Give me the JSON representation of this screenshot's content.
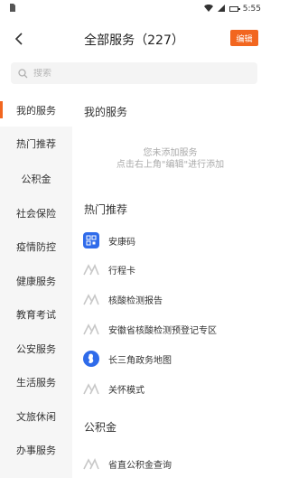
{
  "status_bar": {
    "left_text": "",
    "time": "5:55"
  },
  "header": {
    "title": "全部服务（227）",
    "edit_label": "编辑"
  },
  "search": {
    "placeholder": "搜索"
  },
  "sidebar": {
    "items": [
      {
        "label": "我的服务",
        "active": true
      },
      {
        "label": "热门推荐",
        "active": false
      },
      {
        "label": "公积金",
        "active": false
      },
      {
        "label": "社会保险",
        "active": false
      },
      {
        "label": "疫情防控",
        "active": false
      },
      {
        "label": "健康服务",
        "active": false
      },
      {
        "label": "教育考试",
        "active": false
      },
      {
        "label": "公安服务",
        "active": false
      },
      {
        "label": "生活服务",
        "active": false
      },
      {
        "label": "文旅休闲",
        "active": false
      },
      {
        "label": "办事服务",
        "active": false
      }
    ]
  },
  "main": {
    "my_services": {
      "title": "我的服务",
      "empty_line1": "您未添加服务",
      "empty_line2": "点击右上角\"编辑\"进行添加"
    },
    "hot": {
      "title": "热门推荐",
      "items": [
        {
          "label": "安康码",
          "icon": "qr-code-icon"
        },
        {
          "label": "行程卡",
          "icon": "placeholder-logo-icon"
        },
        {
          "label": "核酸检测报告",
          "icon": "placeholder-logo-icon"
        },
        {
          "label": "安徽省核酸检测预登记专区",
          "icon": "placeholder-logo-icon"
        },
        {
          "label": "长三角政务地图",
          "icon": "map-icon"
        },
        {
          "label": "关怀模式",
          "icon": "placeholder-logo-icon"
        }
      ]
    },
    "fund": {
      "title": "公积金",
      "items": [
        {
          "label": "省直公积金查询",
          "icon": "placeholder-logo-icon"
        }
      ]
    }
  },
  "colors": {
    "accent": "#f2661f",
    "blue_icon": "#2f6bea",
    "sidebar_bg": "#f6f6f6"
  }
}
